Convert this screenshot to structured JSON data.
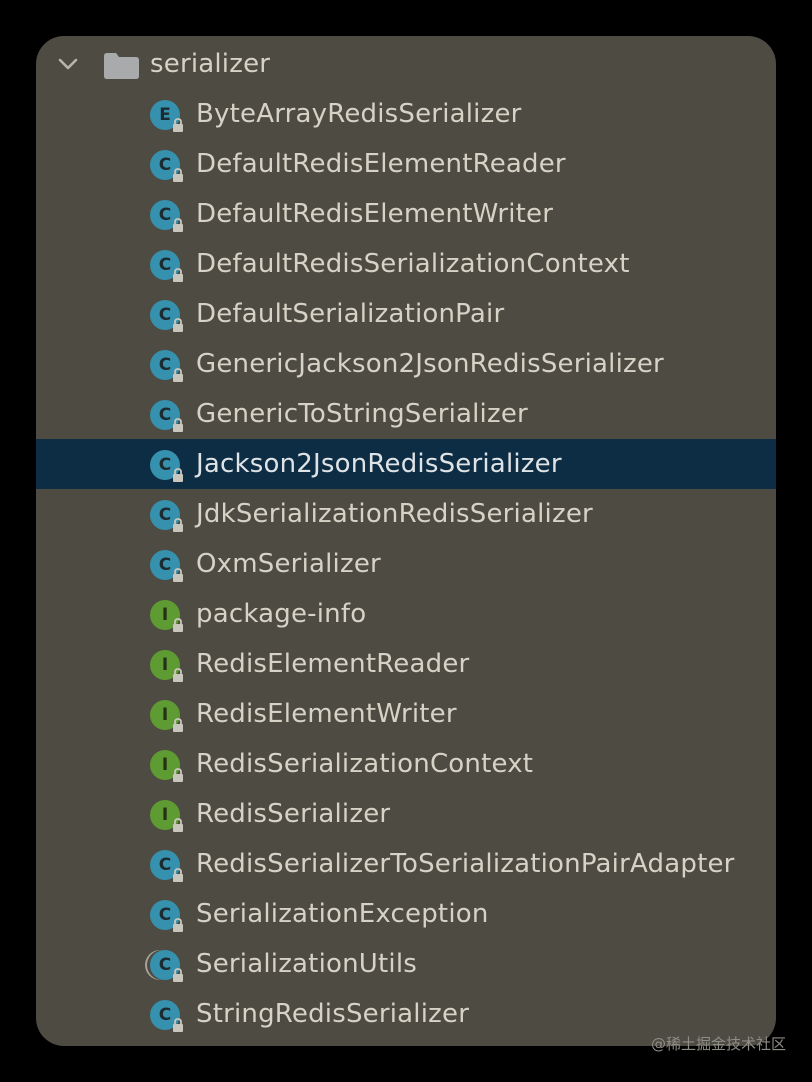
{
  "folder": {
    "name": "serializer",
    "expanded": true,
    "icon": "folder-icon",
    "chevron_icon": "chevron-down-icon"
  },
  "items": [
    {
      "label": "ByteArrayRedisSerializer",
      "kind": "enum",
      "glyph": "E",
      "icon": "enum-icon"
    },
    {
      "label": "DefaultRedisElementReader",
      "kind": "class",
      "glyph": "C",
      "icon": "class-icon"
    },
    {
      "label": "DefaultRedisElementWriter",
      "kind": "class",
      "glyph": "C",
      "icon": "class-icon"
    },
    {
      "label": "DefaultRedisSerializationContext",
      "kind": "class",
      "glyph": "C",
      "icon": "class-icon"
    },
    {
      "label": "DefaultSerializationPair",
      "kind": "class",
      "glyph": "C",
      "icon": "class-icon"
    },
    {
      "label": "GenericJackson2JsonRedisSerializer",
      "kind": "class",
      "glyph": "C",
      "icon": "class-icon"
    },
    {
      "label": "GenericToStringSerializer",
      "kind": "class",
      "glyph": "C",
      "icon": "class-icon"
    },
    {
      "label": "Jackson2JsonRedisSerializer",
      "kind": "class",
      "glyph": "C",
      "icon": "class-icon",
      "selected": true
    },
    {
      "label": "JdkSerializationRedisSerializer",
      "kind": "class",
      "glyph": "C",
      "icon": "class-icon"
    },
    {
      "label": "OxmSerializer",
      "kind": "class",
      "glyph": "C",
      "icon": "class-icon"
    },
    {
      "label": "package-info",
      "kind": "interface",
      "glyph": "I",
      "icon": "interface-icon"
    },
    {
      "label": "RedisElementReader",
      "kind": "interface",
      "glyph": "I",
      "icon": "interface-icon"
    },
    {
      "label": "RedisElementWriter",
      "kind": "interface",
      "glyph": "I",
      "icon": "interface-icon"
    },
    {
      "label": "RedisSerializationContext",
      "kind": "interface",
      "glyph": "I",
      "icon": "interface-icon"
    },
    {
      "label": "RedisSerializer",
      "kind": "interface",
      "glyph": "I",
      "icon": "interface-icon"
    },
    {
      "label": "RedisSerializerToSerializationPairAdapter",
      "kind": "class",
      "glyph": "C",
      "icon": "class-icon"
    },
    {
      "label": "SerializationException",
      "kind": "class",
      "glyph": "C",
      "icon": "class-icon"
    },
    {
      "label": "SerializationUtils",
      "kind": "abstract",
      "glyph": "C",
      "icon": "abstract-class-icon"
    },
    {
      "label": "StringRedisSerializer",
      "kind": "class",
      "glyph": "C",
      "icon": "class-icon"
    }
  ],
  "colors": {
    "panel": "#4d4b42",
    "selected_row": "#0d2d45",
    "text": "#d6d2c6",
    "class_icon": "#3591ad",
    "interface_icon": "#5e9b32"
  },
  "watermark": "@稀土掘金技术社区"
}
